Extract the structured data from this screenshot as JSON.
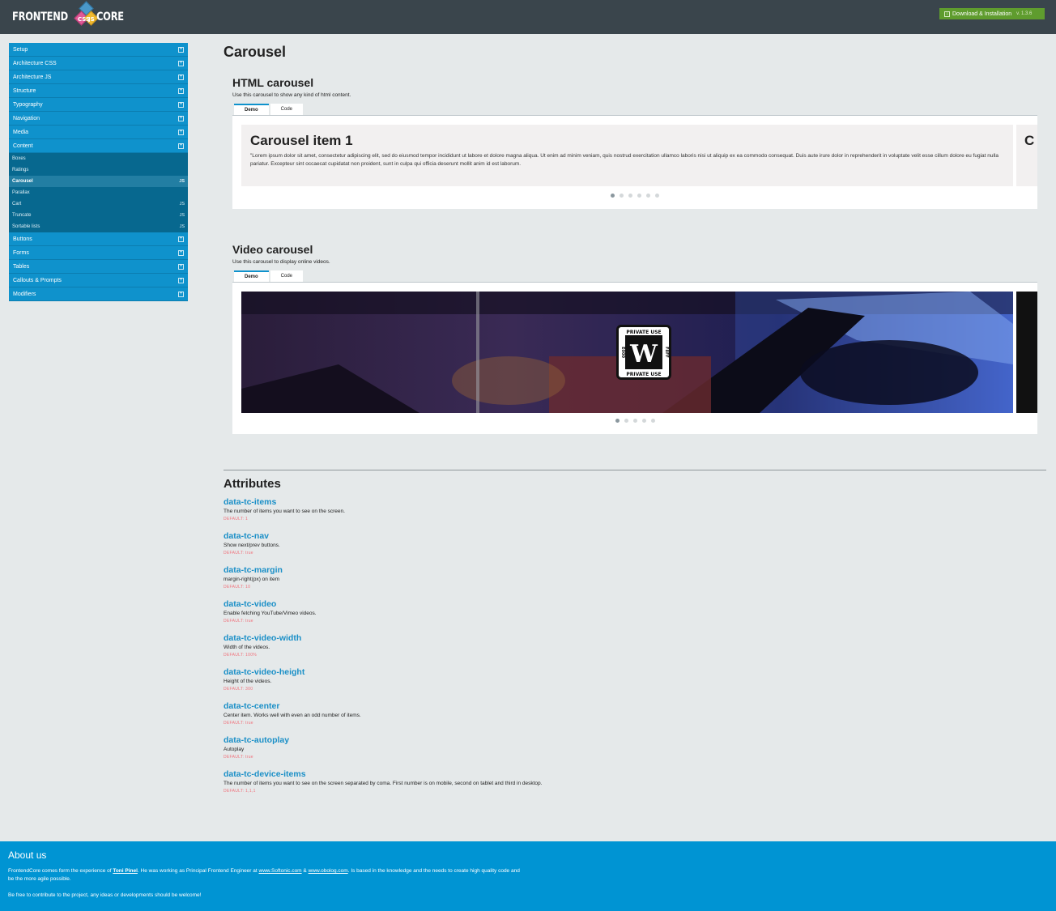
{
  "header": {
    "logo_left": "FRONTEND",
    "logo_css": "CSS",
    "logo_js": "JS",
    "logo_right": "CORE",
    "download_label": "Download & Installation",
    "version": "v. 1.3.6"
  },
  "sidebar": {
    "items_top": [
      {
        "label": "Setup"
      },
      {
        "label": "Architecture CSS"
      },
      {
        "label": "Architecture JS"
      },
      {
        "label": "Structure"
      },
      {
        "label": "Typography"
      },
      {
        "label": "Navigation"
      },
      {
        "label": "Media"
      },
      {
        "label": "Content"
      }
    ],
    "sub_items": [
      {
        "label": "Boxes",
        "badge": ""
      },
      {
        "label": "Ratings",
        "badge": ""
      },
      {
        "label": "Carousel",
        "badge": "JS"
      },
      {
        "label": "Parallax",
        "badge": ""
      },
      {
        "label": "Cart",
        "badge": "JS"
      },
      {
        "label": "Truncate",
        "badge": "JS"
      },
      {
        "label": "Sortable lists",
        "badge": "JS"
      }
    ],
    "items_bottom": [
      {
        "label": "Buttons"
      },
      {
        "label": "Forms"
      },
      {
        "label": "Tables"
      },
      {
        "label": "Callouts & Prompts"
      },
      {
        "label": "Modifiers"
      }
    ],
    "toggle_icon": "plus-box-icon"
  },
  "main": {
    "title": "Carousel",
    "html_section": {
      "title": "HTML carousel",
      "description": "Use this carousel to show any kind of html content.",
      "tabs": [
        "Demo",
        "Code"
      ],
      "slide_title": "Carousel item 1",
      "slide_text": "\"Lorem ipsum dolor sit amet, consectetur adipiscing elit, sed do eiusmod tempor incididunt ut labore et dolore magna aliqua. Ut enim ad minim veniam, quis nostrud exercitation ullamco laboris nisi ut aliquip ex ea commodo consequat. Duis aute irure dolor in reprehenderit in voluptate velit esse cillum dolore eu fugiat nulla pariatur. Excepteur sint occaecat cupidatat non proident, sunt in culpa qui officia deserunt mollit anim id est laborum.",
      "peek_title": "C",
      "dots": 6,
      "active_dot": 0
    },
    "video_section": {
      "title": "Video carousel",
      "description": "Use this carousel to display online videos.",
      "tabs": [
        "Demo",
        "Code"
      ],
      "badge_top": "PRIVATE USE",
      "badge_bottom": "PRIVATE USE",
      "badge_left": "E000",
      "badge_right": "F8FF",
      "dots": 5,
      "active_dot": 0
    }
  },
  "attributes": {
    "title": "Attributes",
    "items": [
      {
        "name": "data-tc-items",
        "desc": "The number of items you want to see on the screen.",
        "default": "DEFAULT: 1"
      },
      {
        "name": "data-tc-nav",
        "desc": "Show next/prev buttons.",
        "default": "DEFAULT: true"
      },
      {
        "name": "data-tc-margin",
        "desc": "margin-right(px) on item",
        "default": "DEFAULT: 10"
      },
      {
        "name": "data-tc-video",
        "desc": "Enable fetching YouTube/Vimeo videos.",
        "default": "DEFAULT: true"
      },
      {
        "name": "data-tc-video-width",
        "desc": "Width of the videos.",
        "default": "DEFAULT: 100%"
      },
      {
        "name": "data-tc-video-height",
        "desc": "Height of the videos.",
        "default": "DEFAULT: 300"
      },
      {
        "name": "data-tc-center",
        "desc": "Center item. Works well with even an odd number of items.",
        "default": "DEFAULT: true"
      },
      {
        "name": "data-tc-autoplay",
        "desc": "Autoplay",
        "default": "DEFAULT: true"
      },
      {
        "name": "data-tc-device-items",
        "desc": "The number of items you want to see on the screen separated by coma. First number is on mobile, second on tablet and third in desktop.",
        "default": "DEFAULT: 1,1,1"
      }
    ]
  },
  "footer": {
    "title": "About us",
    "p1_a": "FrontendCore comes form the experience of ",
    "p1_link1": "Toni Pinel",
    "p1_b": ". He was working as Principal Frontend Engineer at ",
    "p1_link2": "www.Softonic.com",
    "p1_c": " & ",
    "p1_link3": "www.obolog.com",
    "p1_d": ". Is based in the knowledge and the needs to create high quality code and be the more agile possible.",
    "p2": "Be free to contribute to the project, any ideas or developments should be welcome!"
  },
  "colors": {
    "header_bg": "#3a454c",
    "accent": "#0f92cc",
    "download_bg": "#5f9c2e",
    "page_bg": "#e5e9ea",
    "default_text": "#f0727c"
  }
}
